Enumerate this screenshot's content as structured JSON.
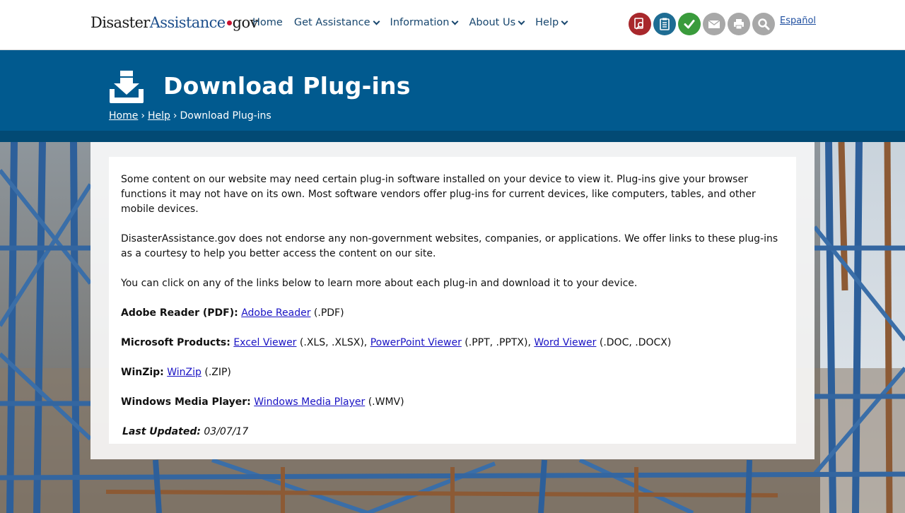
{
  "logo": {
    "part1": "Disaster",
    "part2": "Assistance",
    "part3": "gov"
  },
  "nav": {
    "home": "Home",
    "get_assistance": "Get Assistance",
    "information": "Information",
    "about_us": "About Us",
    "help": "Help"
  },
  "tools": {
    "icons": [
      "find-assistance-icon",
      "checklist-icon",
      "check-status-icon",
      "email-icon",
      "print-icon",
      "search-icon"
    ],
    "colors": [
      "#a8282c",
      "#1e6c93",
      "#3a9b3c",
      "#a8a8a8",
      "#a8a8a8",
      "#a8a8a8"
    ]
  },
  "espanol": "Español",
  "header": {
    "title": "Download Plug-ins",
    "breadcrumb": {
      "home": "Home",
      "help": "Help",
      "sep": "›",
      "current": "Download Plug-ins"
    }
  },
  "content": {
    "p1": "Some content on our website may need certain plug-in software installed on your device to view it. Plug-ins give your browser functions it may not have on its own. Most software vendors offer plug-ins for current devices, like computers, tables, and other mobile devices.",
    "p2": "DisasterAssistance.gov does not endorse any non-government websites, companies, or applications. We offer links to these plug-ins as a courtesy to help you better access the content on our site.",
    "p3": "You can click on any of the links below to learn more about each plug-in and download it to your device.",
    "adobe": {
      "label": "Adobe Reader (PDF):",
      "link": "Adobe Reader",
      "ext": "(.PDF)"
    },
    "microsoft": {
      "label": "Microsoft Products:",
      "excel_link": "Excel Viewer",
      "excel_ext": "(.XLS, .XLSX),",
      "ppt_link": "PowerPoint Viewer",
      "ppt_ext": "(.PPT, .PPTX),",
      "word_link": "Word Viewer",
      "word_ext": "(.DOC, .DOCX)"
    },
    "winzip": {
      "label": "WinZip:",
      "link": "WinZip",
      "ext": "(.ZIP)"
    },
    "wmp": {
      "label": "Windows Media Player:",
      "link": "Windows Media Player",
      "ext": "(.WMV)"
    },
    "updated": {
      "label": "Last Updated:",
      "date": "03/07/17"
    }
  },
  "colors": {
    "band": "#015a8f",
    "link": "#1a13c4",
    "nav": "#17466e"
  }
}
